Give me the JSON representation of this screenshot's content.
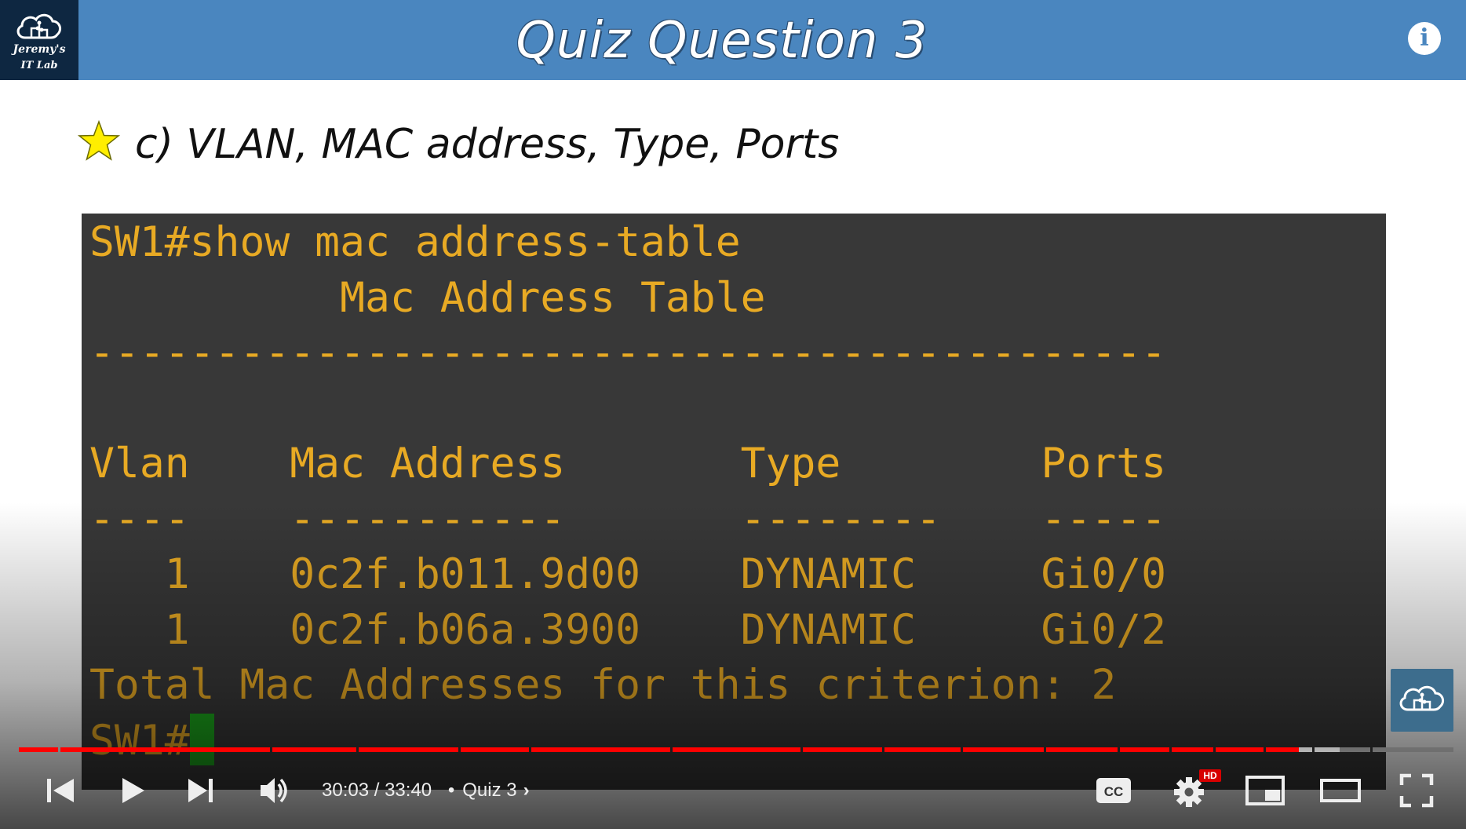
{
  "header": {
    "logo_line1": "Jeremy's",
    "logo_line2": "IT Lab",
    "title": "Quiz Question 3",
    "info_icon": "i"
  },
  "answer": {
    "icon": "star-icon",
    "text": "c) VLAN, MAC address, Type, Ports"
  },
  "terminal": {
    "lines": [
      "SW1#show mac address-table",
      "          Mac Address Table",
      "-------------------------------------------",
      "",
      "Vlan    Mac Address       Type        Ports",
      "----    -----------       --------    -----",
      "   1    0c2f.b011.9d00    DYNAMIC     Gi0/0",
      "   1    0c2f.b06a.3900    DYNAMIC     Gi0/2",
      "Total Mac Addresses for this criterion: 2"
    ],
    "prompt": "SW1#"
  },
  "player": {
    "current_time": "30:03",
    "duration": "33:40",
    "separator": "/",
    "chapter": "Quiz 3",
    "progress_fraction": 0.892,
    "hd_badge": "HD",
    "colors": {
      "played": "#ff0000",
      "buffered": "#b4b4b4",
      "unplayed": "#6f6f6f"
    }
  }
}
